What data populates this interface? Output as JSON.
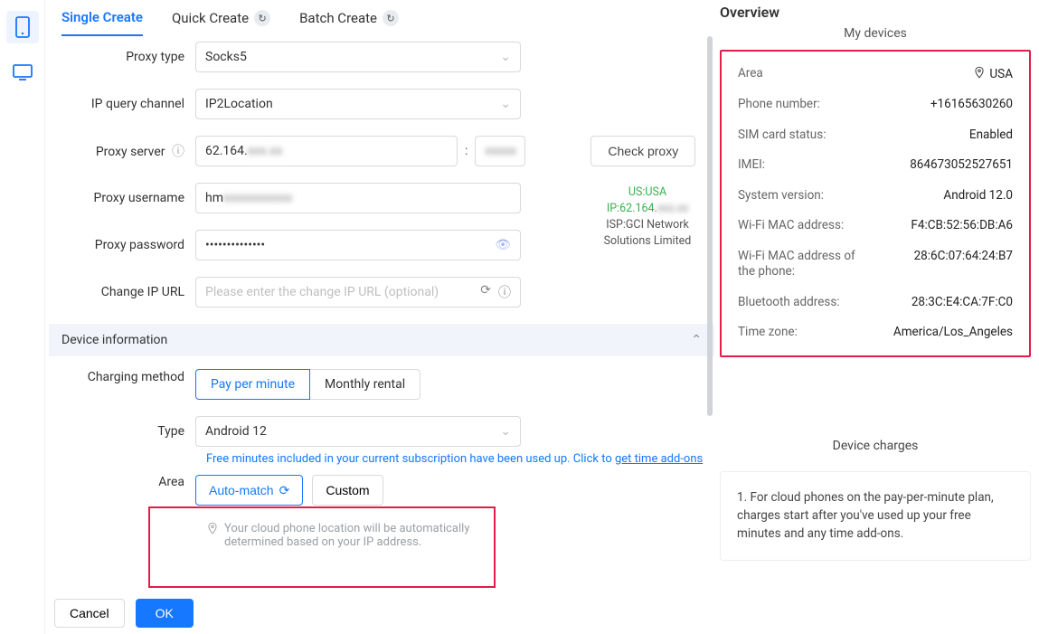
{
  "tabs": {
    "single": "Single Create",
    "quick": "Quick Create",
    "batch": "Batch Create"
  },
  "labels": {
    "proxy_type": "Proxy type",
    "ip_query": "IP query channel",
    "proxy_server": "Proxy server",
    "proxy_username": "Proxy username",
    "proxy_password": "Proxy password",
    "change_ip_url": "Change IP URL",
    "device_info": "Device information",
    "charging_method": "Charging method",
    "type": "Type",
    "area": "Area"
  },
  "values": {
    "proxy_type": "Socks5",
    "ip_query": "IP2Location",
    "proxy_host": "62.164.",
    "proxy_host_blur": "xxx.xx",
    "proxy_port_blur": "xxxxx",
    "proxy_username_prefix": "hm",
    "proxy_username_blur": "xxxxxxxxxxx",
    "proxy_password": "••••••••••••••",
    "change_ip_placeholder": "Please enter the change IP URL (optional)",
    "type_select": "Android 12"
  },
  "buttons": {
    "check_proxy": "Check proxy",
    "pay_per_minute": "Pay per minute",
    "monthly_rental": "Monthly rental",
    "auto_match": "Auto-match",
    "custom": "Custom",
    "cancel": "Cancel",
    "ok": "OK"
  },
  "notes": {
    "free_minutes_pre": "Free minutes included in your current subscription have been used up. Click to ",
    "free_minutes_link": "get time add-ons",
    "auto_note": "Your cloud phone location will be automatically determined based on your IP address."
  },
  "proxy_result": {
    "country": "US:USA",
    "ip_pre": "IP:62.164.",
    "ip_blur": "xxx.xx",
    "isp": "ISP:GCI Network Solutions Limited"
  },
  "overview": {
    "title": "Overview",
    "subtitle": "My devices",
    "rows": {
      "area_k": "Area",
      "area_v": "USA",
      "phone_k": "Phone number:",
      "phone_v": "+16165630260",
      "sim_k": "SIM card status:",
      "sim_v": "Enabled",
      "imei_k": "IMEI:",
      "imei_v": "864673052527651",
      "sys_k": "System version:",
      "sys_v": "Android 12.0",
      "wifi_k": "Wi-Fi MAC address:",
      "wifi_v": "F4:CB:52:56:DB:A6",
      "wifip_k": "Wi-Fi MAC address of the phone:",
      "wifip_v": "28:6C:07:64:24:B7",
      "bt_k": "Bluetooth address:",
      "bt_v": "28:3C:E4:CA:7F:C0",
      "tz_k": "Time zone:",
      "tz_v": "America/Los_Angeles"
    }
  },
  "charges": {
    "title": "Device charges",
    "item1": "1. For cloud phones on the pay-per-minute plan, charges start after you've used up your free minutes and any time add-ons."
  }
}
